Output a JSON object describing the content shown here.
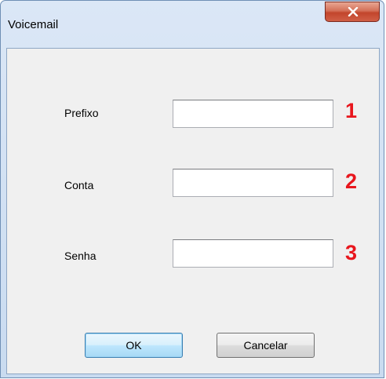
{
  "window": {
    "title": "Voicemail"
  },
  "fields": [
    {
      "label": "Prefixo",
      "value": "",
      "number": "1"
    },
    {
      "label": "Conta",
      "value": "",
      "number": "2"
    },
    {
      "label": "Senha",
      "value": "",
      "number": "3"
    }
  ],
  "buttons": {
    "ok_label": "OK",
    "cancel_label": "Cancelar"
  },
  "colors": {
    "annotation_red": "#e8161d",
    "close_button": "#c2452c"
  },
  "icons": {
    "close": "close-icon"
  }
}
